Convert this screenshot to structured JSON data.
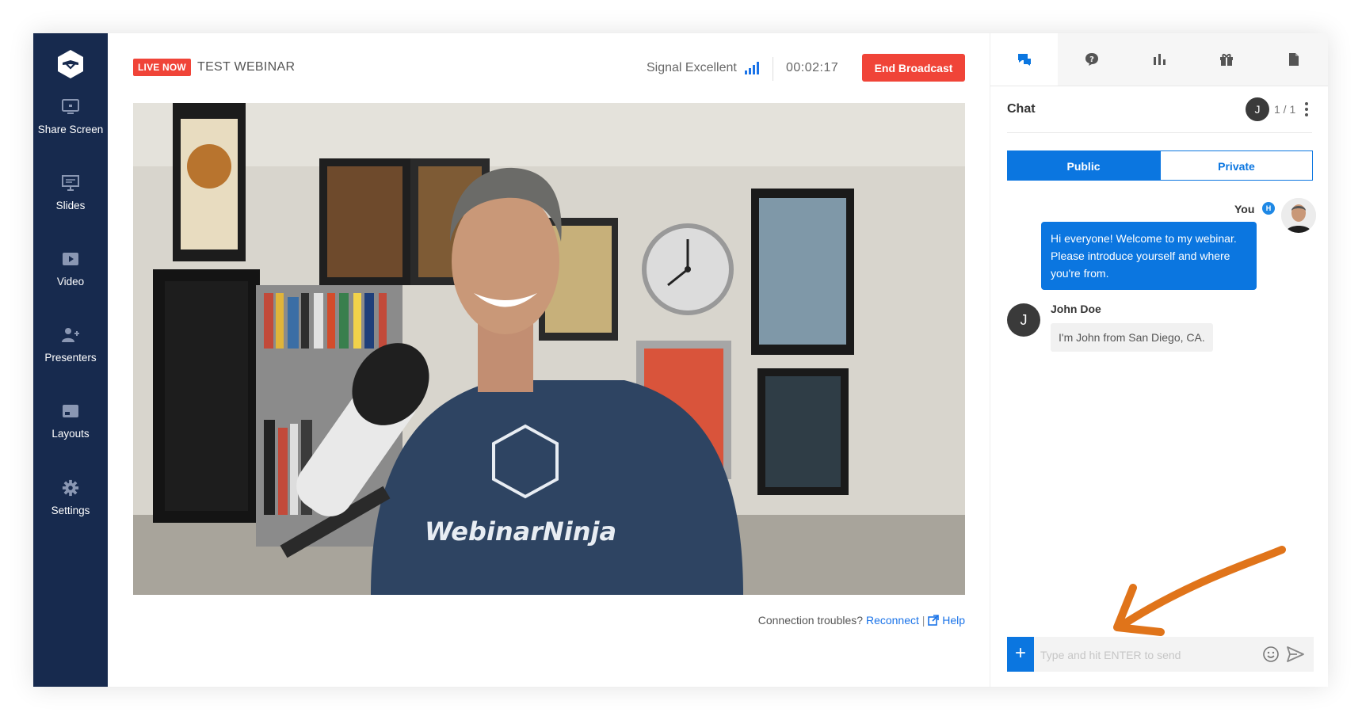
{
  "sidebar": {
    "items": [
      {
        "label": "Share Screen",
        "icon": "monitor-icon"
      },
      {
        "label": "Slides",
        "icon": "presentation-icon"
      },
      {
        "label": "Video",
        "icon": "play-icon"
      },
      {
        "label": "Presenters",
        "icon": "user-add-icon"
      },
      {
        "label": "Layouts",
        "icon": "layout-icon"
      },
      {
        "label": "Settings",
        "icon": "gear-icon"
      }
    ]
  },
  "header": {
    "live_badge": "LIVE NOW",
    "title": "TEST WEBINAR",
    "signal": "Signal Excellent",
    "timer": "00:02:17",
    "end_button": "End Broadcast"
  },
  "connection": {
    "text": "Connection troubles?",
    "reconnect": "Reconnect",
    "separator": "|",
    "help": "Help"
  },
  "panel": {
    "tabs": [
      {
        "icon": "chat-icon",
        "active": true
      },
      {
        "icon": "question-icon",
        "active": false
      },
      {
        "icon": "poll-icon",
        "active": false
      },
      {
        "icon": "gift-icon",
        "active": false
      },
      {
        "icon": "document-icon",
        "active": false
      }
    ],
    "chat_title": "Chat",
    "user_initial": "J",
    "user_count": "1 / 1",
    "segments": {
      "public": "Public",
      "private": "Private"
    },
    "messages": [
      {
        "author": "You",
        "badge": "H",
        "text": "Hi everyone! Welcome to my webinar. Please introduce yourself and where you're from.",
        "outgoing": true
      },
      {
        "author": "John Doe",
        "initial": "J",
        "text": "I'm John from San Diego, CA.",
        "outgoing": false
      }
    ],
    "input_placeholder": "Type and hit ENTER to send",
    "plus_label": "+"
  },
  "colors": {
    "sidebar": "#172a4e",
    "accent_blue": "#0b76e0",
    "live_red": "#f04438",
    "annotation_arrow": "#e0741a"
  }
}
